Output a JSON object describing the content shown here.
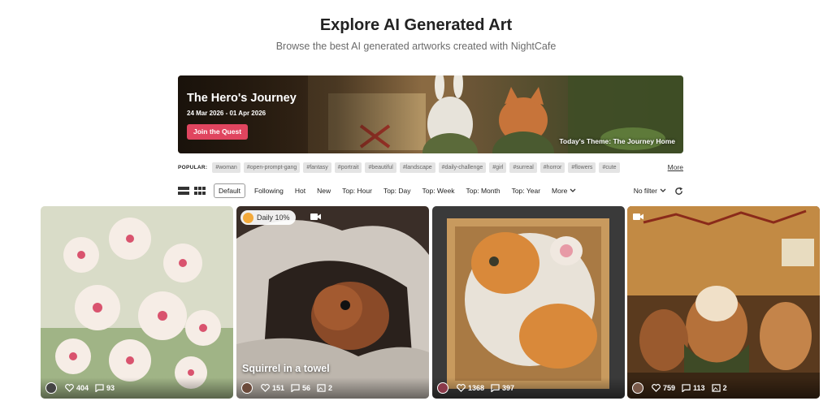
{
  "header": {
    "title": "Explore AI Generated Art",
    "subtitle": "Browse the best AI generated artworks created with NightCafe"
  },
  "banner": {
    "title": "The Hero's Journey",
    "dates": "24 Mar 2026 - 01 Apr 2026",
    "button_label": "Join the Quest",
    "theme": "Today's Theme: The Journey Home"
  },
  "popular": {
    "label": "POPULAR:",
    "tags": [
      "#woman",
      "#open-prompt-gang",
      "#fantasy",
      "#portrait",
      "#beautiful",
      "#landscape",
      "#daily-challenge",
      "#girl",
      "#surreal",
      "#horror",
      "#flowers",
      "#cute"
    ],
    "more_label": "More"
  },
  "filters": {
    "sorts": [
      "Default",
      "Following",
      "Hot",
      "New",
      "Top: Hour",
      "Top: Day",
      "Top: Week",
      "Top: Month",
      "Top: Year",
      "More"
    ],
    "active_sort": "Default",
    "filter_label": "No filter"
  },
  "cards": [
    {
      "likes": "404",
      "comments": "93"
    },
    {
      "badge": "Daily 10%",
      "caption": "Squirrel in a towel",
      "likes": "151",
      "comments": "56",
      "images": "2"
    },
    {
      "likes": "1368",
      "comments": "397"
    },
    {
      "likes": "759",
      "comments": "113",
      "images": "2"
    }
  ],
  "colors": {
    "accent": "#e0455f",
    "tag_bg": "#e4e4e4"
  }
}
